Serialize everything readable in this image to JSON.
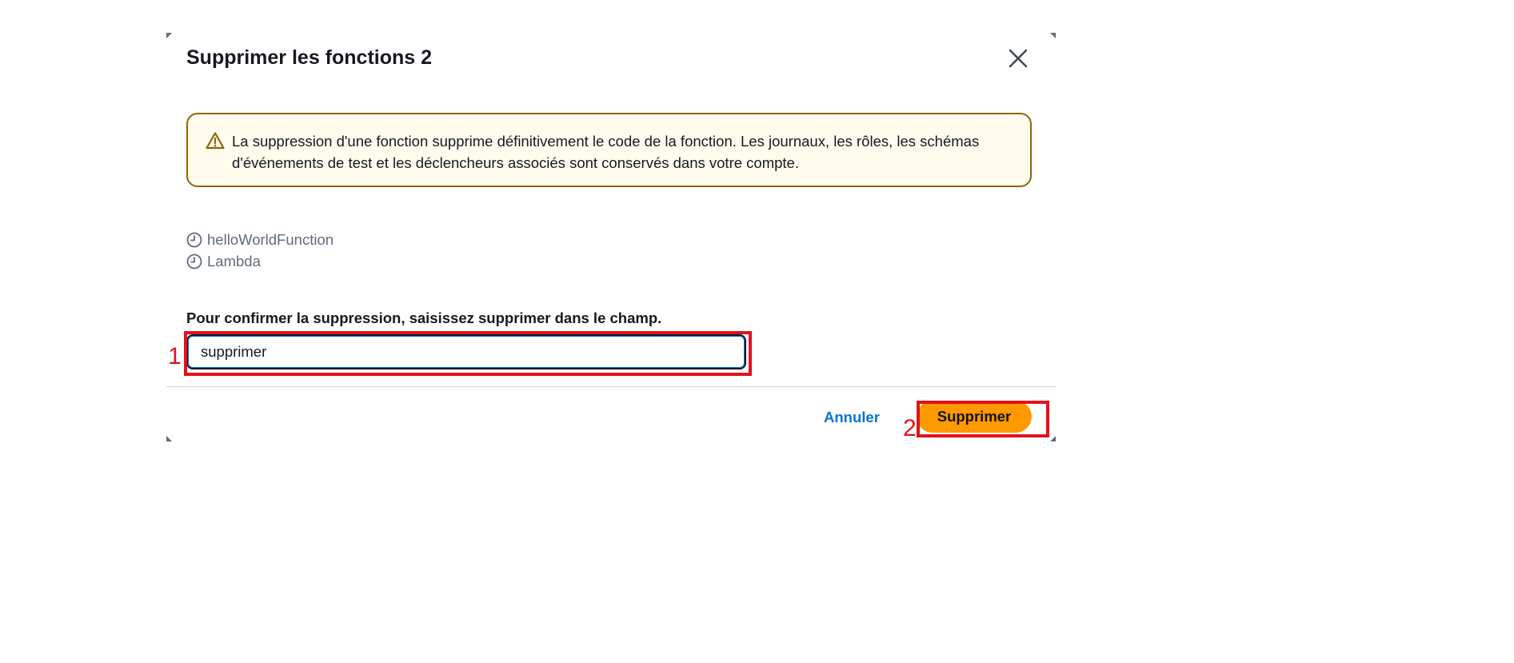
{
  "dialog": {
    "title": "Supprimer les fonctions 2",
    "close_icon": "close-icon"
  },
  "alert": {
    "type": "warning",
    "icon": "warning-triangle-icon",
    "message": "La suppression d'une fonction supprime définitivement le code de la fonction. Les journaux, les rôles, les schémas d'événements de test et les déclencheurs associés sont conservés dans votre compte.",
    "border_color": "#8d6605",
    "background_color": "#fffbed"
  },
  "resources": [
    {
      "icon": "clock-icon",
      "name": "helloWorldFunction"
    },
    {
      "icon": "clock-icon",
      "name": "Lambda"
    }
  ],
  "confirm": {
    "label_prefix": "Pour confirmer la suppression, saisissez ",
    "label_keyword": "supprimer",
    "label_suffix": " dans le champ.",
    "input_value": "supprimer"
  },
  "footer": {
    "cancel_label": "Annuler",
    "submit_label": "Supprimer",
    "submit_color": "#ff9900",
    "link_color": "#0972d3"
  },
  "annotations": [
    {
      "label": "1",
      "target": "confirm-input"
    },
    {
      "label": "2",
      "target": "delete-button"
    }
  ]
}
